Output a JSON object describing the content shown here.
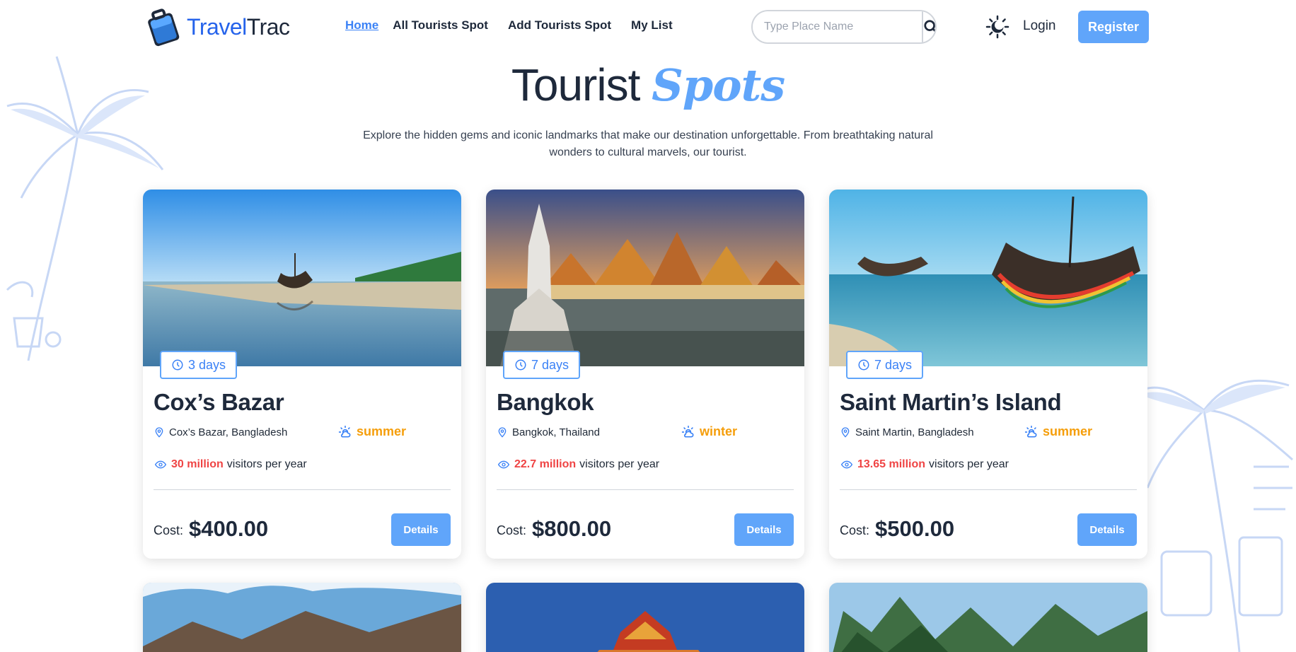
{
  "brand": {
    "name_part1": "Travel",
    "name_part2": "Trac"
  },
  "nav": {
    "items": [
      {
        "label": "Home",
        "active": true
      },
      {
        "label": "All Tourists Spot",
        "active": false
      },
      {
        "label": "Add Tourists Spot",
        "active": false
      },
      {
        "label": "My List",
        "active": false
      }
    ]
  },
  "search": {
    "placeholder": "Type Place Name",
    "value": ""
  },
  "auth": {
    "login_label": "Login",
    "register_label": "Register"
  },
  "hero": {
    "title_plain": "Tourist",
    "title_script": "Spots",
    "desc_line1": "Explore the hidden gems and iconic landmarks that make our destination unforgettable. From breathtaking natural",
    "desc_line2": "wonders to cultural marvels, our tourist."
  },
  "cards": [
    {
      "duration": "3 days",
      "title": "Cox’s Bazar",
      "location": "Cox’s Bazar, Bangladesh",
      "season": "summer",
      "visitors_num": "30 million",
      "visitors_text": "visitors per year",
      "cost_label": "Cost:",
      "cost": "$400.00",
      "details_label": "Details"
    },
    {
      "duration": "7 days",
      "title": "Bangkok",
      "location": "Bangkok, Thailand",
      "season": "winter",
      "visitors_num": "22.7 million",
      "visitors_text": "visitors per year",
      "cost_label": "Cost:",
      "cost": "$800.00",
      "details_label": "Details"
    },
    {
      "duration": "7 days",
      "title": "Saint Martin’s Island",
      "location": "Saint Martin, Bangladesh",
      "season": "summer",
      "visitors_num": "13.65 million",
      "visitors_text": "visitors per year",
      "cost_label": "Cost:",
      "cost": "$500.00",
      "details_label": "Details"
    }
  ],
  "colors": {
    "accent": "#60a5fa",
    "link_active": "#3b82f6",
    "season": "#f59e0b",
    "visitors": "#ef4444"
  },
  "icons": {
    "logo": "luggage-logo-icon",
    "search": "search-icon",
    "theme": "theme-toggle-icon",
    "duration": "clock-icon",
    "location": "map-pin-icon",
    "season": "sun-cloud-icon",
    "visitors": "eye-icon"
  }
}
